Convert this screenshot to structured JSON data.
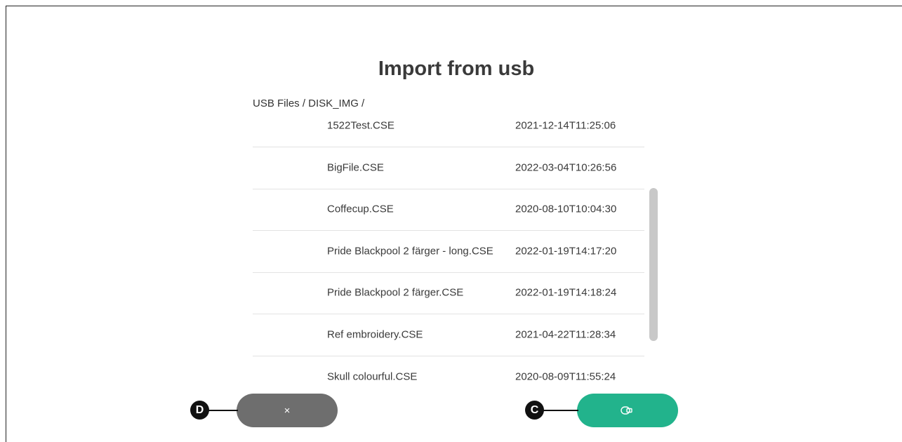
{
  "dialog": {
    "title": "Import from usb",
    "breadcrumb": "USB Files / DISK_IMG /"
  },
  "files": [
    {
      "name": "1522Test.CSE",
      "date": "2021-12-14T11:25:06"
    },
    {
      "name": "BigFile.CSE",
      "date": "2022-03-04T10:26:56"
    },
    {
      "name": "Coffecup.CSE",
      "date": "2020-08-10T10:04:30"
    },
    {
      "name": "Pride Blackpool 2 färger - long.CSE",
      "date": "2022-01-19T14:17:20"
    },
    {
      "name": "Pride Blackpool 2 färger.CSE",
      "date": "2022-01-19T14:18:24"
    },
    {
      "name": "Ref embroidery.CSE",
      "date": "2021-04-22T11:28:34"
    },
    {
      "name": "Skull colourful.CSE",
      "date": "2020-08-09T11:55:24"
    }
  ],
  "buttons": {
    "cancel_label": "×",
    "cancel_icon": "close-icon",
    "import_icon": "import-icon"
  },
  "callouts": {
    "cancel_marker": "D",
    "import_marker": "C"
  },
  "colors": {
    "cancel_button": "#6e6e6e",
    "import_button": "#22b38c",
    "scrollbar": "#c8c8c8"
  }
}
